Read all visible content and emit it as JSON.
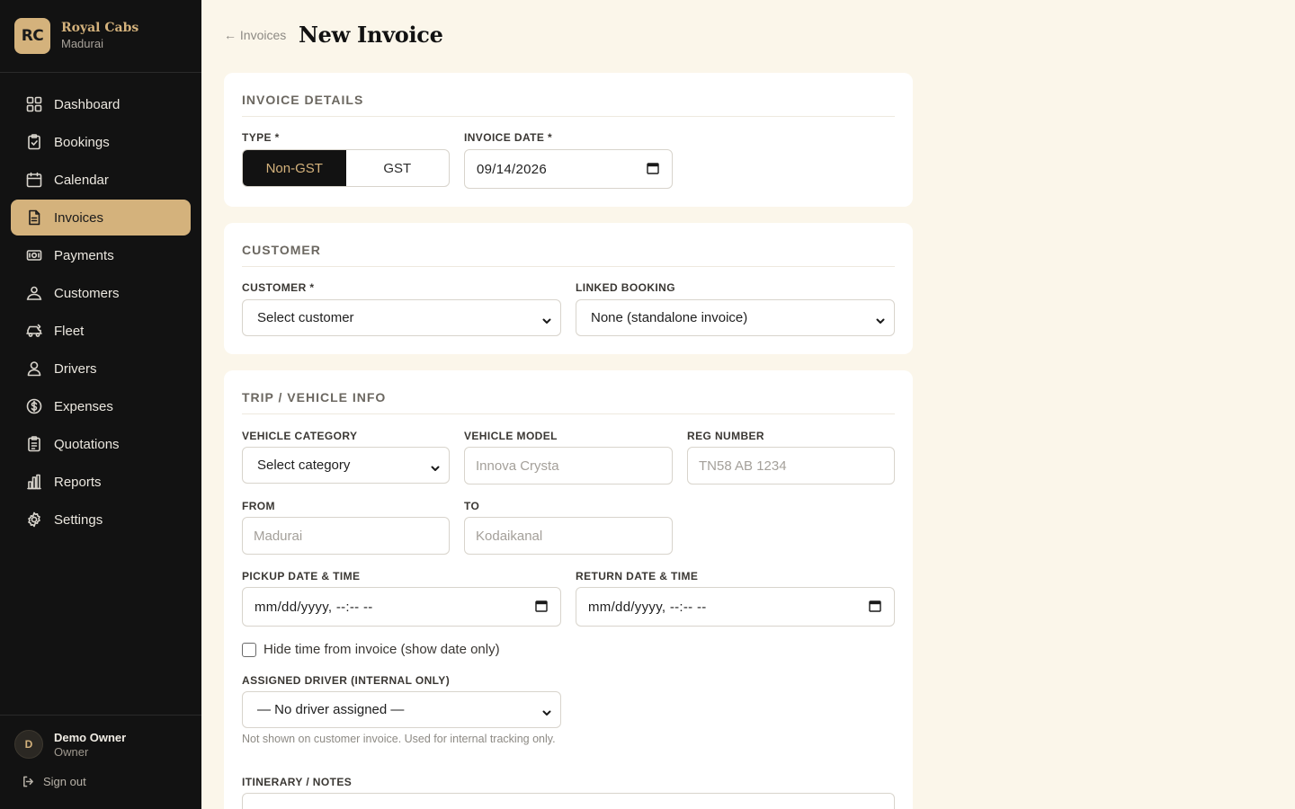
{
  "brand": {
    "initials": "RC",
    "name": "Royal Cabs",
    "city": "Madurai"
  },
  "nav": [
    {
      "label": "Dashboard",
      "icon": "grid-icon"
    },
    {
      "label": "Bookings",
      "icon": "clipboard-check-icon"
    },
    {
      "label": "Calendar",
      "icon": "calendar-icon"
    },
    {
      "label": "Invoices",
      "icon": "document-icon",
      "active": true
    },
    {
      "label": "Payments",
      "icon": "banknote-icon"
    },
    {
      "label": "Customers",
      "icon": "users-icon"
    },
    {
      "label": "Fleet",
      "icon": "car-icon"
    },
    {
      "label": "Drivers",
      "icon": "user-icon"
    },
    {
      "label": "Expenses",
      "icon": "dollar-circle-icon"
    },
    {
      "label": "Quotations",
      "icon": "clipboard-list-icon"
    },
    {
      "label": "Reports",
      "icon": "bar-chart-icon"
    },
    {
      "label": "Settings",
      "icon": "gear-icon"
    }
  ],
  "user": {
    "initial": "D",
    "name": "Demo Owner",
    "role": "Owner",
    "signout": "Sign out"
  },
  "header": {
    "back": "← Invoices",
    "title": "New Invoice"
  },
  "invoice_details": {
    "title": "Invoice Details",
    "type_label": "Type *",
    "type_options": [
      "Non-GST",
      "GST"
    ],
    "type_selected": "Non-GST",
    "date_label": "Invoice Date *",
    "date_value": "09/14/2026"
  },
  "customer": {
    "title": "Customer",
    "customer_label": "Customer *",
    "customer_value": "Select customer",
    "booking_label": "Linked Booking",
    "booking_value": "None (standalone invoice)"
  },
  "trip": {
    "title": "Trip / Vehicle Info",
    "category_label": "Vehicle Category",
    "category_value": "Select category",
    "model_label": "Vehicle Model",
    "model_placeholder": "Innova Crysta",
    "reg_label": "Reg Number",
    "reg_placeholder": "TN58 AB 1234",
    "from_label": "From",
    "from_placeholder": "Madurai",
    "to_label": "To",
    "to_placeholder": "Kodaikanal",
    "pickup_label": "Pickup Date & Time",
    "pickup_value": "mm/dd/yyyy, --:-- --",
    "return_label": "Return Date & Time",
    "return_value": "mm/dd/yyyy, --:-- --",
    "hide_time_label": "Hide time from invoice (show date only)",
    "driver_label": "Assigned Driver (Internal Only)",
    "driver_value": "— No driver assigned —",
    "driver_hint": "Not shown on customer invoice. Used for internal tracking only.",
    "notes_label": "Itinerary / Notes"
  }
}
